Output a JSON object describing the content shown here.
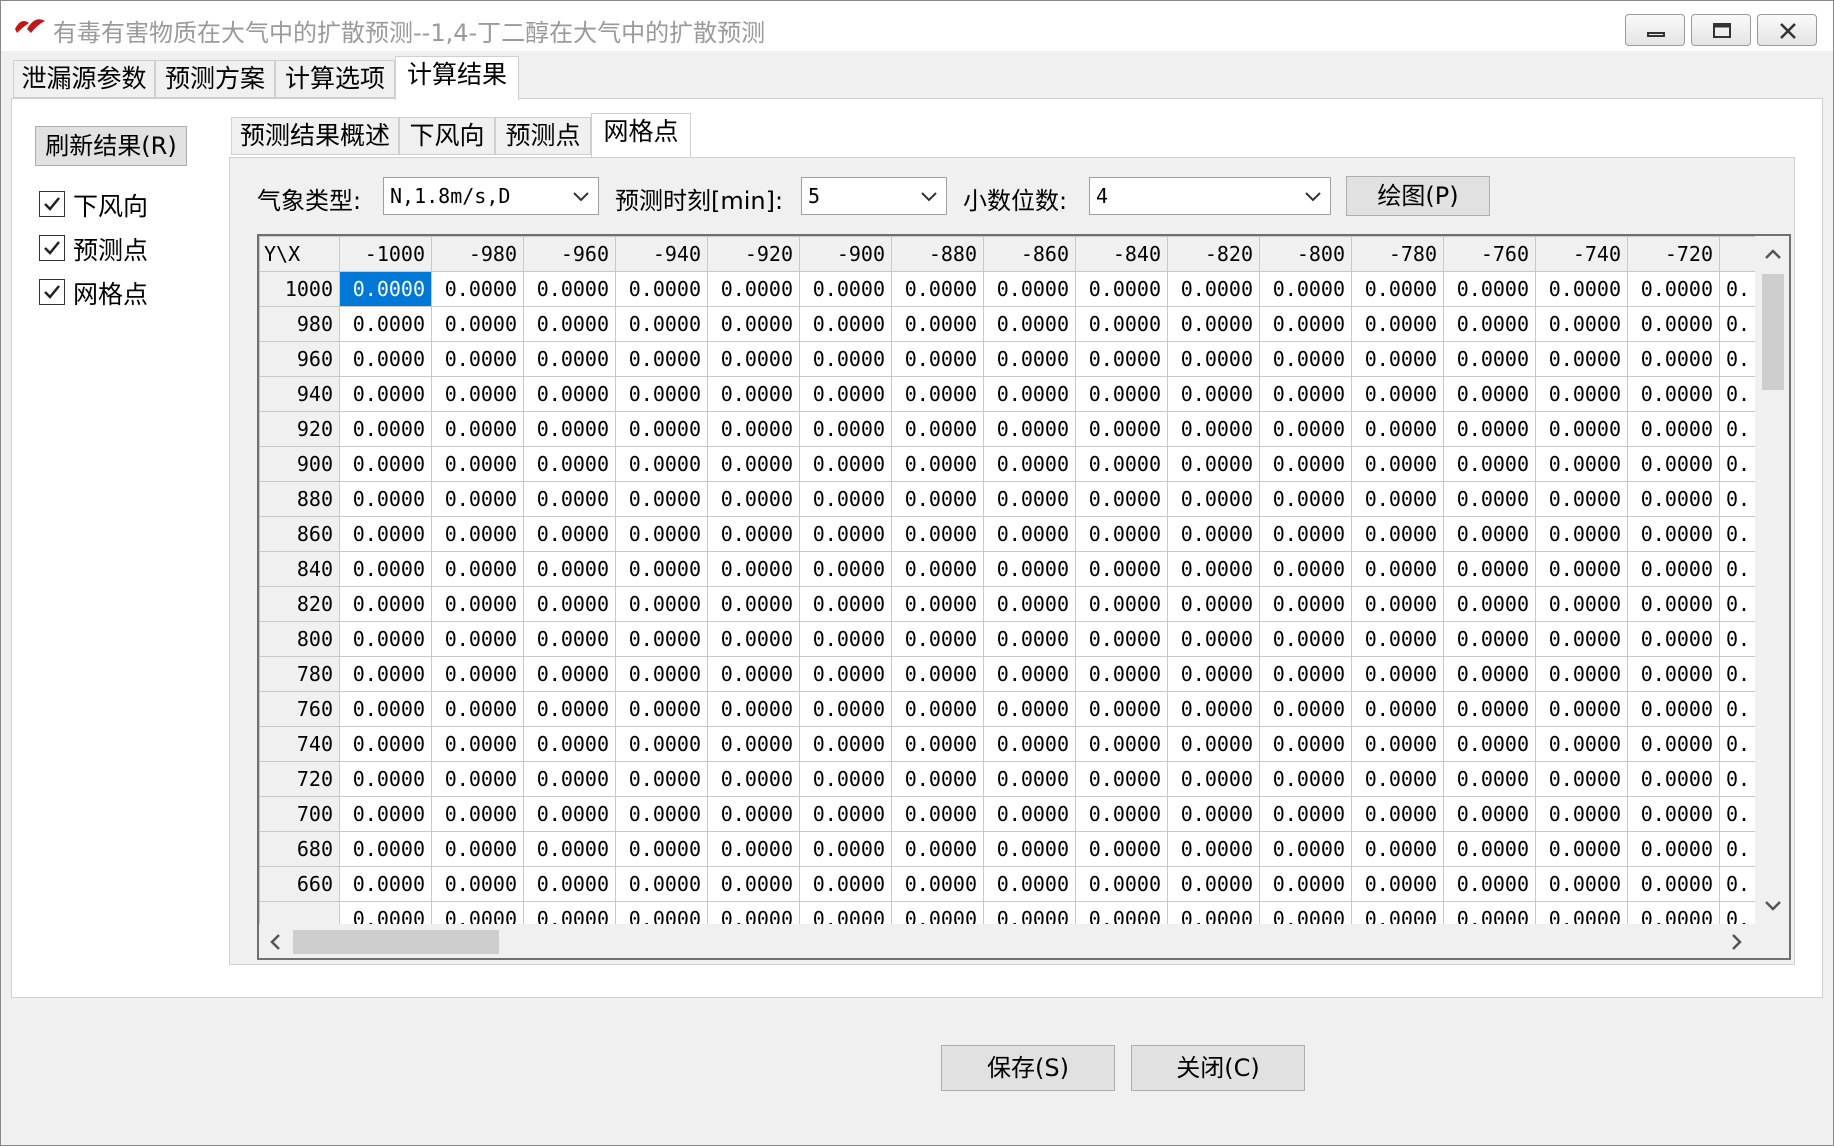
{
  "window": {
    "title": "有毒有害物质在大气中的扩散预测--1,4-丁二醇在大气中的扩散预测",
    "controls": [
      "minimize",
      "maximize",
      "close"
    ]
  },
  "main_tabs": [
    {
      "label": "泄漏源参数",
      "active": false
    },
    {
      "label": "预测方案",
      "active": false
    },
    {
      "label": "计算选项",
      "active": false
    },
    {
      "label": "计算结果",
      "active": true
    }
  ],
  "left_panel": {
    "refresh_button": "刷新结果(R)",
    "checkboxes": [
      {
        "label": "下风向",
        "checked": true
      },
      {
        "label": "预测点",
        "checked": true
      },
      {
        "label": "网格点",
        "checked": true
      }
    ]
  },
  "sub_tabs": [
    {
      "label": "预测结果概述",
      "active": false
    },
    {
      "label": "下风向",
      "active": false
    },
    {
      "label": "预测点",
      "active": false
    },
    {
      "label": "网格点",
      "active": true
    }
  ],
  "toolbar": {
    "weather_label": "气象类型:",
    "weather_value": "N,1.8m/s,D",
    "time_label": "预测时刻[min]:",
    "time_value": "5",
    "decimals_label": "小数位数:",
    "decimals_value": "4",
    "plot_button": "绘图(P)"
  },
  "grid": {
    "corner": "Y\\X",
    "columns": [
      "-1000",
      "-980",
      "-960",
      "-940",
      "-920",
      "-900",
      "-880",
      "-860",
      "-840",
      "-820",
      "-800",
      "-780",
      "-760",
      "-740",
      "-720",
      ""
    ],
    "rows": [
      "1000",
      "980",
      "960",
      "940",
      "920",
      "900",
      "880",
      "860",
      "840",
      "820",
      "800",
      "780",
      "760",
      "740",
      "720",
      "700",
      "680",
      "660",
      ""
    ],
    "cell_value": "0.0000",
    "partial_cell_value": "0.",
    "selected_cell": {
      "row": 0,
      "col": 0
    }
  },
  "footer": {
    "save_button": "保存(S)",
    "close_button": "关闭(C)"
  },
  "colors": {
    "selection": "#0078d7",
    "title_text": "#9a9a9a",
    "app_icon": "#c01818"
  }
}
